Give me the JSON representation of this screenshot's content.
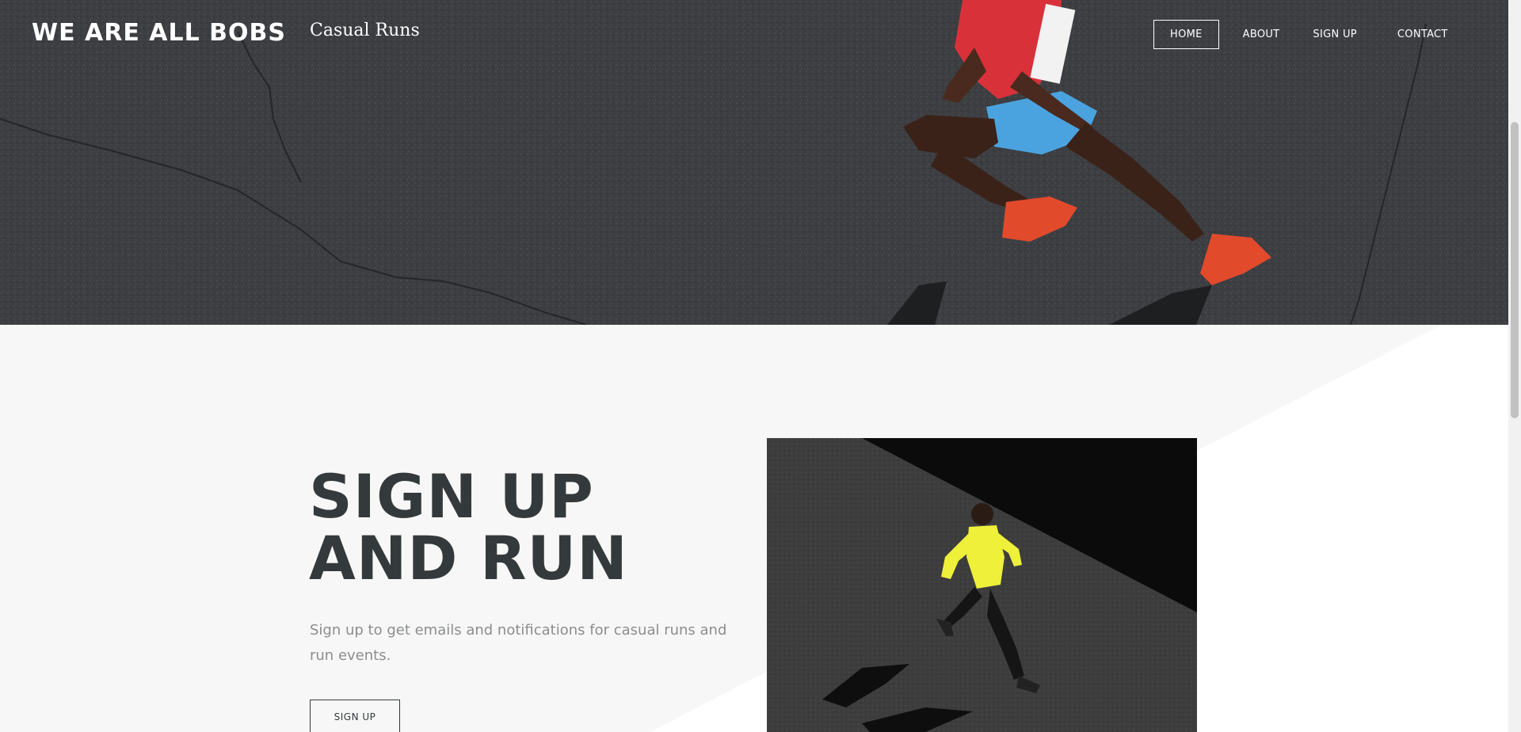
{
  "header": {
    "brand": "WE ARE ALL BOBS",
    "tagline": "Casual Runs",
    "nav": [
      {
        "label": "HOME",
        "active": true
      },
      {
        "label": "ABOUT",
        "active": false
      },
      {
        "label": "SIGN UP",
        "active": false
      },
      {
        "label": "CONTACT",
        "active": false
      }
    ]
  },
  "signup_section": {
    "headline_line1": "SIGN UP",
    "headline_line2": "AND RUN",
    "description": "Sign up to get emails and notifications for casual runs and run events.",
    "button_label": "SIGN UP"
  },
  "colors": {
    "heading": "#343a3b",
    "body_text": "#8b8d8e",
    "section_bg": "#f7f7f7",
    "hero_bg": "#3a3c3f"
  }
}
